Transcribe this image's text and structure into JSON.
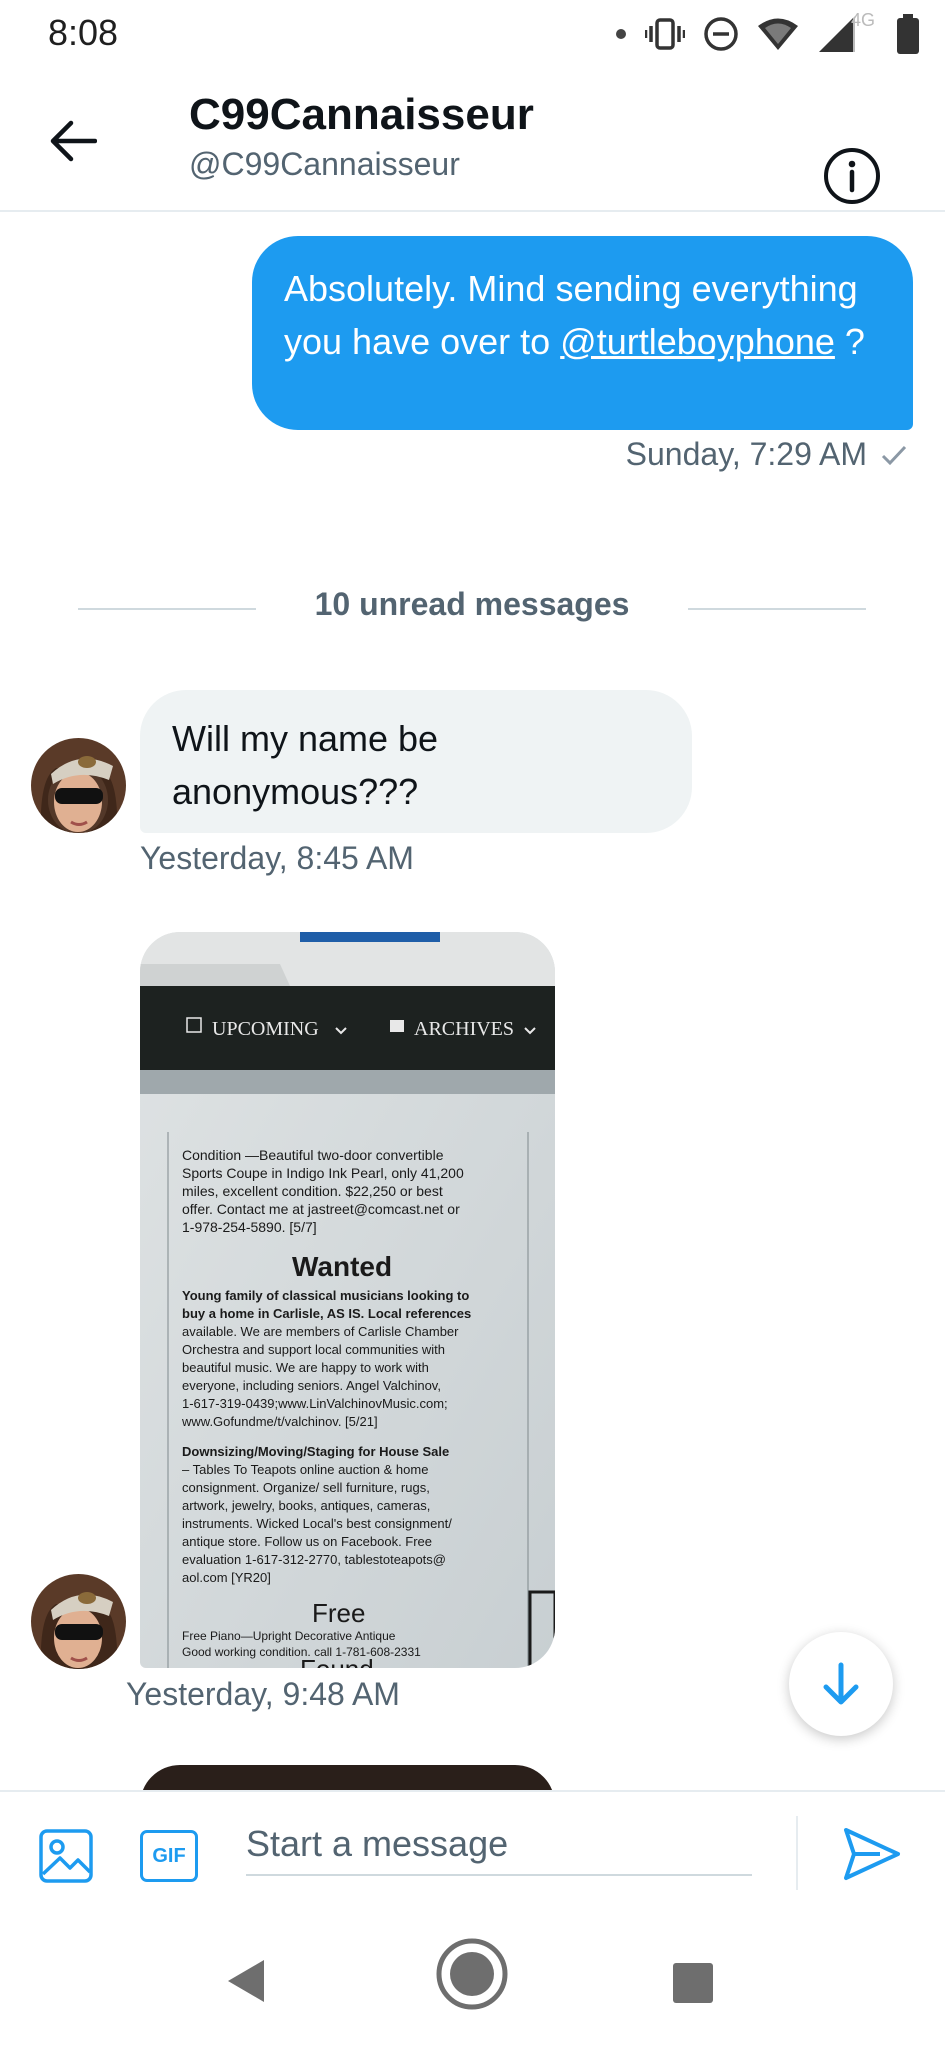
{
  "status_bar": {
    "time": "8:08",
    "network": "4G"
  },
  "header": {
    "name": "C99Cannaisseur",
    "handle": "@C99Cannaisseur"
  },
  "messages": {
    "outgoing_1": {
      "text_before": "Absolutely. Mind sending everything you have over to ",
      "mention": "@turtleboyphone",
      "text_after": " ?",
      "timestamp": "Sunday, 7:29 AM"
    },
    "unread_divider": "10 unread messages",
    "incoming_1": {
      "text": "Will my name be anonymous???",
      "timestamp": "Yesterday, 8:45 AM"
    },
    "incoming_2": {
      "timestamp": "Yesterday, 9:48 AM",
      "photo": {
        "nav_upcoming": "UPCOMING",
        "nav_archives": "ARCHIVES",
        "top_lines": [
          "Condition —Beautiful two-door convertible",
          "Sports Coupe in Indigo Ink Pearl, only 41,200",
          "miles, excellent condition. $22,250 or best",
          "offer. Contact me at jastreet@comcast.net or",
          "1-978-254-5890. [5/7]"
        ],
        "heading_wanted": "Wanted",
        "wanted_lines": [
          "Young family of classical musicians looking to",
          "buy a home in Carlisle, AS IS. Local references",
          "available. We are members of Carlisle Chamber",
          "Orchestra and support local communities with",
          "beautiful music. We are happy to work with",
          "everyone, including seniors. Angel Valchinov,",
          "1-617-319-0439;www.LinValchinovMusic.com;",
          "www.Gofundme/t/valchinov. [5/21]"
        ],
        "downsizing_lines": [
          "Downsizing/Moving/Staging for House Sale",
          "– Tables To Teapots online auction & home",
          "consignment. Organize/ sell furniture, rugs,",
          "artwork, jewelry, books, antiques, cameras,",
          "instruments. Wicked Local's best consignment/",
          "antique store. Follow us on Facebook. Free",
          "evaluation 1-617-312-2770, tablestoteapots@",
          "aol.com [YR20]"
        ],
        "heading_free": "Free",
        "free_lines": [
          "Free Piano—Upright Decorative Antique",
          "Good working condition. call 1-781-608-2331"
        ],
        "heading_found": "Found"
      }
    }
  },
  "composer": {
    "placeholder": "Start a message",
    "gif_label": "GIF"
  },
  "colors": {
    "accent": "#1d9bf0",
    "secondary_text": "#536471",
    "incoming_bubble": "#eff3f4"
  },
  "icons": {
    "back": "arrow-left-icon",
    "info": "info-circle-icon",
    "media": "image-icon",
    "send": "send-icon",
    "scroll_down": "arrow-down-icon"
  }
}
